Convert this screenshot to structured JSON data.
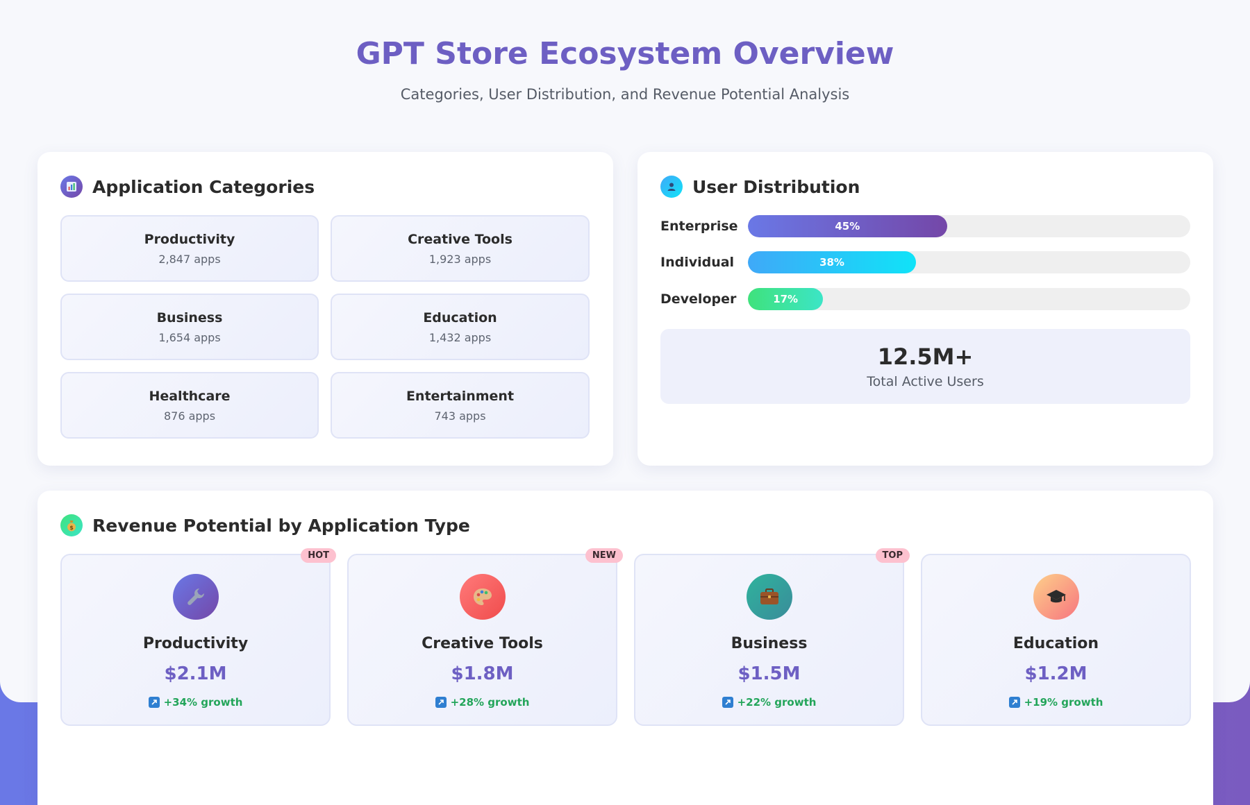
{
  "header": {
    "title": "GPT Store Ecosystem Overview",
    "subtitle": "Categories, User Distribution, and Revenue Potential Analysis"
  },
  "categories_panel": {
    "title": "Application Categories",
    "icon": "bar-chart-icon",
    "items": [
      {
        "name": "Productivity",
        "count": "2,847 apps"
      },
      {
        "name": "Creative Tools",
        "count": "1,923 apps"
      },
      {
        "name": "Business",
        "count": "1,654 apps"
      },
      {
        "name": "Education",
        "count": "1,432 apps"
      },
      {
        "name": "Healthcare",
        "count": "876 apps"
      },
      {
        "name": "Entertainment",
        "count": "743 apps"
      }
    ]
  },
  "users_panel": {
    "title": "User Distribution",
    "icon": "user-icon",
    "rows": [
      {
        "label": "Enterprise",
        "percent": 45,
        "value": "45%",
        "color_start": "#6a78e6",
        "color_end": "#7447a8"
      },
      {
        "label": "Individual",
        "percent": 38,
        "value": "38%",
        "color_start": "#3fa9f8",
        "color_end": "#10e3f8"
      },
      {
        "label": "Developer",
        "percent": 17,
        "value": "17%",
        "color_start": "#3fe27c",
        "color_end": "#3ce5c6"
      }
    ],
    "total": {
      "value": "12.5M+",
      "label": "Total Active Users"
    }
  },
  "revenue_panel": {
    "title": "Revenue Potential by Application Type",
    "icon": "money-bag-icon",
    "cards": [
      {
        "name": "Productivity",
        "value": "$2.1M",
        "growth": "+34% growth",
        "badge": "HOT",
        "icon": "wrench-icon",
        "color_start": "#6a78e6",
        "color_end": "#7447a8"
      },
      {
        "name": "Creative Tools",
        "value": "$1.8M",
        "growth": "+28% growth",
        "badge": "NEW",
        "icon": "palette-icon",
        "color_start": "#ff7a7a",
        "color_end": "#f04c4c"
      },
      {
        "name": "Business",
        "value": "$1.5M",
        "growth": "+22% growth",
        "badge": "TOP",
        "icon": "briefcase-icon",
        "color_start": "#2fb39d",
        "color_end": "#3a8c9a"
      },
      {
        "name": "Education",
        "value": "$1.2M",
        "growth": "+19% growth",
        "badge": "",
        "icon": "graduation-cap-icon",
        "color_start": "#fdd08a",
        "color_end": "#f7757f"
      }
    ]
  },
  "colors": {
    "accent": "#6d5fc3",
    "growth": "#23a55a",
    "badge": "#fdc1cf"
  }
}
